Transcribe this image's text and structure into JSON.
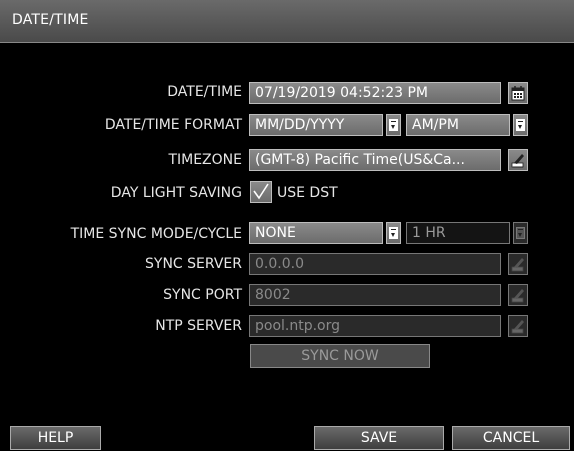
{
  "title": "DATE/TIME",
  "rows": {
    "datetime": {
      "label": "DATE/TIME",
      "value": "07/19/2019 04:52:23 PM",
      "icon": "calendar-icon"
    },
    "format": {
      "label": "DATE/TIME FORMAT",
      "date_value": "MM/DD/YYYY",
      "time_value": "AM/PM"
    },
    "timezone": {
      "label": "TIMEZONE",
      "value": "(GMT-8) Pacific Time(US&Ca...",
      "icon": "edit-icon"
    },
    "dst": {
      "label": "DAY LIGHT SAVING",
      "checkbox_label": "USE DST",
      "checked": true
    },
    "sync_mode": {
      "label": "TIME SYNC MODE/CYCLE",
      "mode_value": "NONE",
      "cycle_value": "1 HR"
    },
    "sync_server": {
      "label": "SYNC SERVER",
      "value": "0.0.0.0"
    },
    "sync_port": {
      "label": "SYNC PORT",
      "value": "8002"
    },
    "ntp_server": {
      "label": "NTP SERVER",
      "value": "pool.ntp.org"
    }
  },
  "sync_now_label": "SYNC NOW",
  "buttons": {
    "help": "HELP",
    "save": "SAVE",
    "cancel": "CANCEL"
  },
  "colors": {
    "titlebar": "#555555",
    "field": "#7a7a7a",
    "background": "#000000"
  }
}
